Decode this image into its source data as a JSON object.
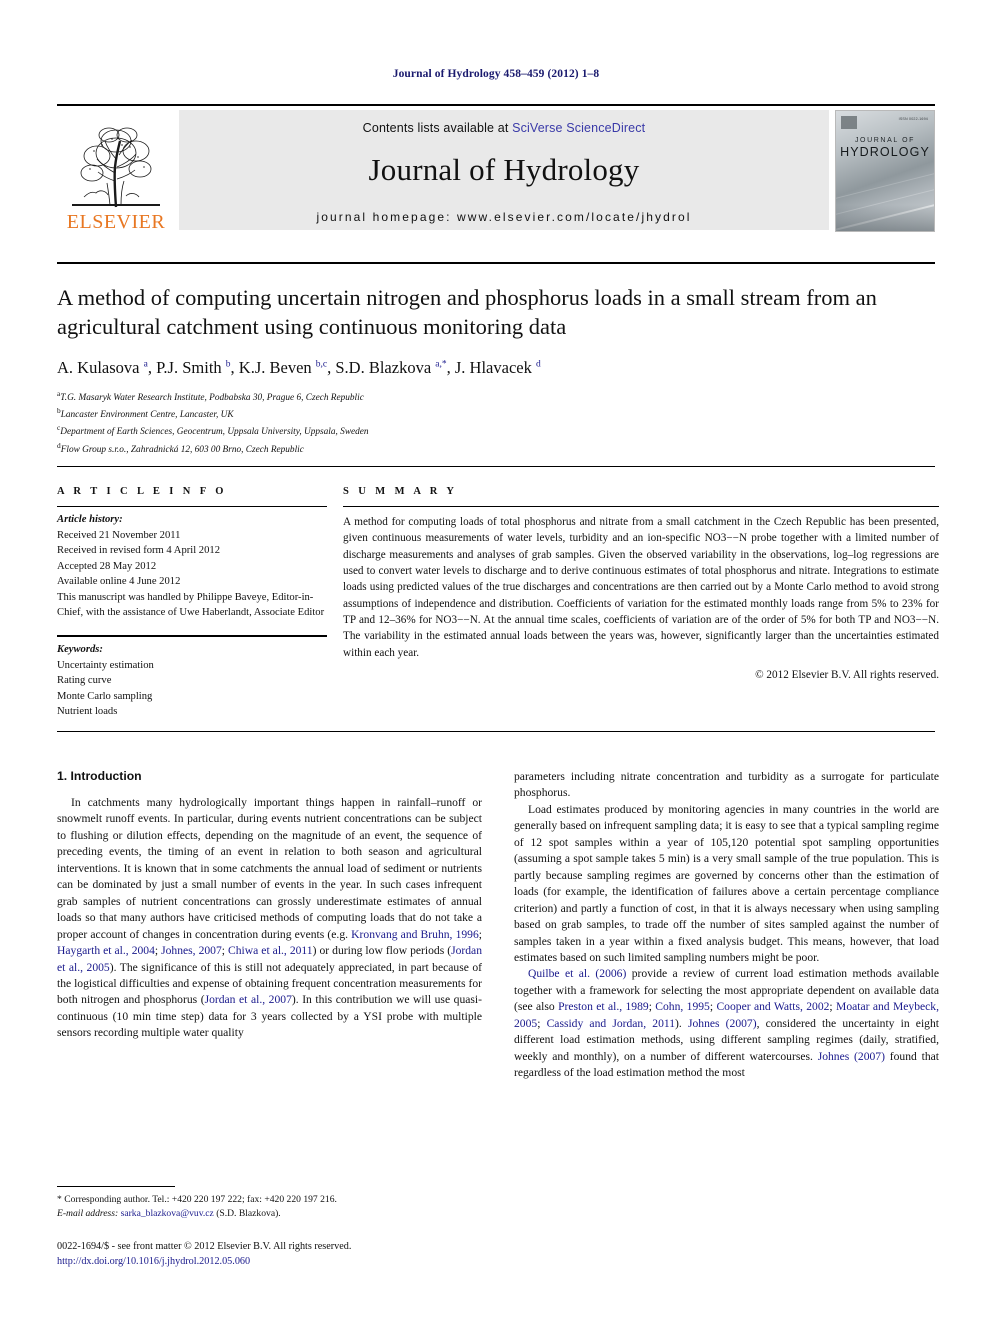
{
  "running_head": "Journal of Hydrology 458–459 (2012) 1–8",
  "masthead": {
    "contents_prefix": "Contents lists available at ",
    "sciencedirect_link": "SciVerse ScienceDirect",
    "journal_title": "Journal of Hydrology",
    "homepage_line": "journal homepage: www.elsevier.com/locate/jhydrol",
    "elsevier_wordmark": "ELSEVIER",
    "cover": {
      "line1": "JOURNAL OF",
      "line2": "HYDROLOGY",
      "code": "ISSN 0022-1694"
    }
  },
  "article": {
    "title": "A method of computing uncertain nitrogen and phosphorus loads in a small stream from an agricultural catchment using continuous monitoring data",
    "authors_html": "A. Kulasova <sup>a</sup>, P.J. Smith <sup>b</sup>, K.J. Beven <sup>b,c</sup>, S.D. Blazkova <sup>a,*</sup>, J. Hlavacek <sup>d</sup>",
    "affiliations": [
      {
        "mark": "a",
        "text": "T.G. Masaryk Water Research Institute, Podbabska 30, Prague 6, Czech Republic"
      },
      {
        "mark": "b",
        "text": "Lancaster Environment Centre, Lancaster, UK"
      },
      {
        "mark": "c",
        "text": "Department of Earth Sciences, Geocentrum, Uppsala University, Uppsala, Sweden"
      },
      {
        "mark": "d",
        "text": "Flow Group s.r.o., Zahradnická 12, 603 00 Brno, Czech Republic"
      }
    ]
  },
  "article_info": {
    "heading": "A R T I C L E  I N F O",
    "history_label": "Article history:",
    "history": [
      "Received 21 November 2011",
      "Received in revised form 4 April 2012",
      "Accepted 28 May 2012",
      "Available online 4 June 2012",
      "This manuscript was handled by Philippe Baveye, Editor-in-Chief, with the assistance of Uwe Haberlandt, Associate Editor"
    ],
    "keywords_label": "Keywords:",
    "keywords": [
      "Uncertainty estimation",
      "Rating curve",
      "Monte Carlo sampling",
      "Nutrient loads"
    ]
  },
  "summary": {
    "heading": "S U M M A R Y",
    "text": "A method for computing loads of total phosphorus and nitrate from a small catchment in the Czech Republic has been presented, given continuous measurements of water levels, turbidity and an ion-specific NO3−−N probe together with a limited number of discharge measurements and analyses of grab samples. Given the observed variability in the observations, log–log regressions are used to convert water levels to discharge and to derive continuous estimates of total phosphorus and nitrate. Integrations to estimate loads using predicted values of the true discharges and concentrations are then carried out by a Monte Carlo method to avoid strong assumptions of independence and distribution. Coefficients of variation for the estimated monthly loads range from 5% to 23% for TP and 12–36% for NO3−−N. At the annual time scales, coefficients of variation are of the order of 5% for both TP and NO3−−N. The variability in the estimated annual loads between the years was, however, significantly larger than the uncertainties estimated within each year.",
    "copyright": "© 2012 Elsevier B.V. All rights reserved."
  },
  "introduction": {
    "heading": "1. Introduction",
    "left_paragraph_1": "In catchments many hydrologically important things happen in rainfall–runoff or snowmelt runoff events. In particular, during events nutrient concentrations can be subject to flushing or dilution effects, depending on the magnitude of an event, the sequence of preceding events, the timing of an event in relation to both season and agricultural interventions. It is known that in some catchments the annual load of sediment or nutrients can be dominated by just a small number of events in the year. In such cases infrequent grab samples of nutrient concentrations can grossly underestimate estimates of annual loads so that many authors have criticised methods of computing loads that do not take a proper account of changes in concentration during events (e.g. Kronvang and Bruhn, 1996; Haygarth et al., 2004; Johnes, 2007; Chiwa et al., 2011) or during low flow periods (Jordan et al., 2005). The significance of this is still not adequately appreciated, in part because of the logistical difficulties and expense of obtaining frequent concentration measurements for both nitrogen and phosphorus (Jordan et al., 2007). In this contribution we will use quasi-continuous (10 min time step) data for 3 years collected by a YSI probe with multiple sensors recording multiple water quality",
    "right_continuation": "parameters including nitrate concentration and turbidity as a surrogate for particulate phosphorus.",
    "right_paragraph_2": "Load estimates produced by monitoring agencies in many countries in the world are generally based on infrequent sampling data; it is easy to see that a typical sampling regime of 12 spot samples within a year of 105,120 potential spot sampling opportunities (assuming a spot sample takes 5 min) is a very small sample of the true population. This is partly because sampling regimes are governed by concerns other than the estimation of loads (for example, the identification of failures above a certain percentage compliance criterion) and partly a function of cost, in that it is always necessary when using sampling based on grab samples, to trade off the number of sites sampled against the number of samples taken in a year within a fixed analysis budget. This means, however, that load estimates based on such limited sampling numbers might be poor.",
    "right_paragraph_3": "Quilbe et al. (2006) provide a review of current load estimation methods available together with a framework for selecting the most appropriate dependent on available data (see also Preston et al., 1989; Cohn, 1995; Cooper and Watts, 2002; Moatar and Meybeck, 2005; Cassidy and Jordan, 2011). Johnes (2007), considered the uncertainty in eight different load estimation methods, using different sampling regimes (daily, stratified, weekly and monthly), on a number of different watercourses. Johnes (2007) found that regardless of the load estimation method the most"
  },
  "footnotes": {
    "corresponding": "* Corresponding author. Tel.: +420 220 197 222; fax: +420 220 197 216.",
    "email_label": "E-mail address:",
    "email": "sarka_blazkova@vuv.cz",
    "email_suffix": " (S.D. Blazkova).",
    "imprint": "0022-1694/$ - see front matter © 2012 Elsevier B.V. All rights reserved.",
    "doi": "http://dx.doi.org/10.1016/j.jhydrol.2012.05.060"
  },
  "colors": {
    "running_head": "#1a1a6e",
    "link": "#1a1a8c",
    "elsevier_orange": "#E87722",
    "masthead_band": "#e9e9e9"
  }
}
